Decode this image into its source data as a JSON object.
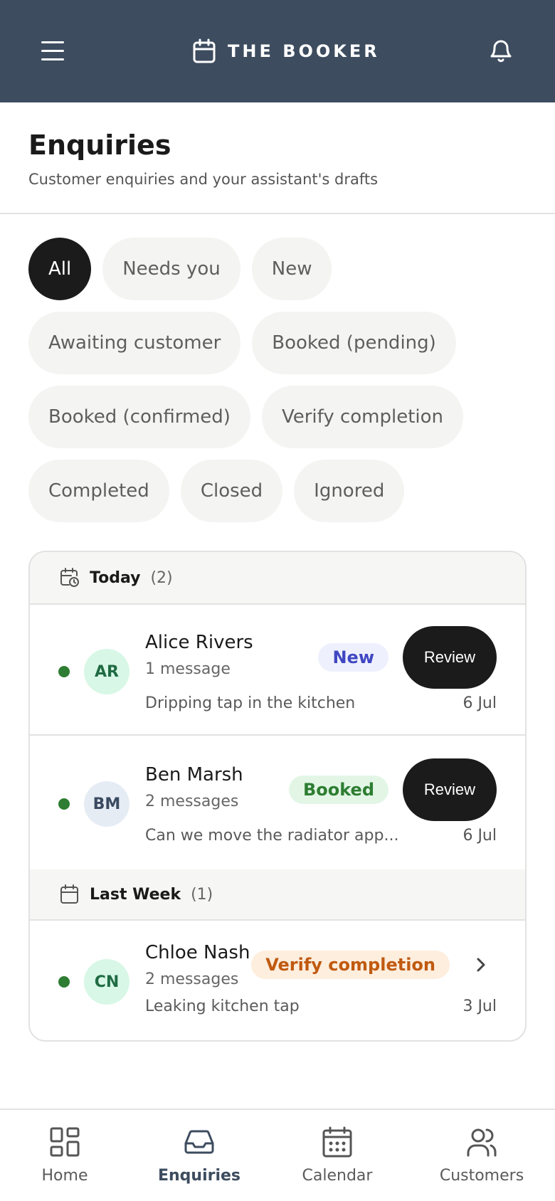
{
  "header": {
    "brand": "THE BOOKER",
    "menu_icon": "hamburger-menu-icon",
    "brand_icon": "calendar-icon",
    "bell_icon": "bell-icon",
    "bg_color": "#3d4c5f"
  },
  "page": {
    "title": "Enquiries",
    "subtitle": "Customer enquiries and your assistant's drafts"
  },
  "filters": [
    {
      "label": "All",
      "active": true
    },
    {
      "label": "Needs you",
      "active": false
    },
    {
      "label": "New",
      "active": false
    },
    {
      "label": "Awaiting customer",
      "active": false
    },
    {
      "label": "Booked (pending)",
      "active": false
    },
    {
      "label": "Booked (confirmed)",
      "active": false
    },
    {
      "label": "Verify completion",
      "active": false
    },
    {
      "label": "Completed",
      "active": false
    },
    {
      "label": "Closed",
      "active": false
    },
    {
      "label": "Ignored",
      "active": false
    }
  ],
  "groups": {
    "today": {
      "title": "Today",
      "count": "(2)",
      "icon": "calendar-clock-icon"
    },
    "last_week": {
      "title": "Last Week",
      "count": "(1)",
      "icon": "calendar-icon"
    }
  },
  "enquiries": [
    {
      "initials": "AR",
      "name": "Alice Rivers",
      "messages": "1 message",
      "preview": "Dripping tap in the kitchen",
      "badge": "New",
      "date": "6 Jul",
      "action": "Review"
    },
    {
      "initials": "BM",
      "name": "Ben Marsh",
      "messages": "2 messages",
      "preview": "Can we move the radiator app...",
      "badge": "Booked",
      "date": "6 Jul",
      "action": "Review"
    },
    {
      "initials": "CN",
      "name": "Chloe Nash",
      "messages": "2 messages",
      "preview": "Leaking kitchen tap",
      "badge": "Verify completion",
      "date": "3 Jul"
    }
  ],
  "nav": [
    {
      "label": "Home",
      "icon": "grid-icon",
      "active": false
    },
    {
      "label": "Enquiries",
      "icon": "inbox-icon",
      "active": true
    },
    {
      "label": "Calendar",
      "icon": "calendar-icon",
      "active": false
    },
    {
      "label": "Customers",
      "icon": "users-icon",
      "active": false
    }
  ],
  "colors": {
    "unread_dot": "#2e7d32",
    "new_badge": "#4047c2",
    "booked_badge": "#2e7d32",
    "verify_badge": "#c05a10"
  }
}
